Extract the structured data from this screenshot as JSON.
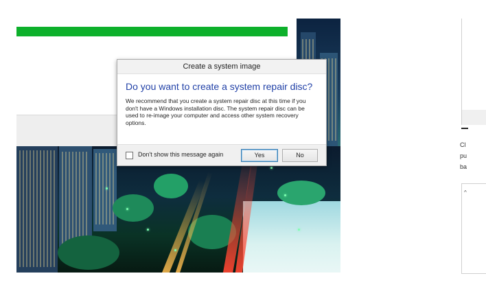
{
  "progress": {
    "fraction": 1.0,
    "color": "#0db02b"
  },
  "dialog": {
    "title": "Create a system image",
    "heading": "Do you want to create a system repair disc?",
    "message": "We recommend that you create a system repair disc at this time if you don't have a Windows installation disc. The system repair disc can be used to re-image your computer and access other system recovery options.",
    "checkbox_label": "Don't show this message again",
    "checkbox_checked": false,
    "yes_label": "Yes",
    "no_label": "No"
  },
  "right_pane": {
    "lines": [
      "Cl",
      "pu",
      "ba"
    ],
    "box_mark": "^"
  },
  "colors": {
    "heading": "#1f3fa6",
    "accent": "#0db02b"
  }
}
